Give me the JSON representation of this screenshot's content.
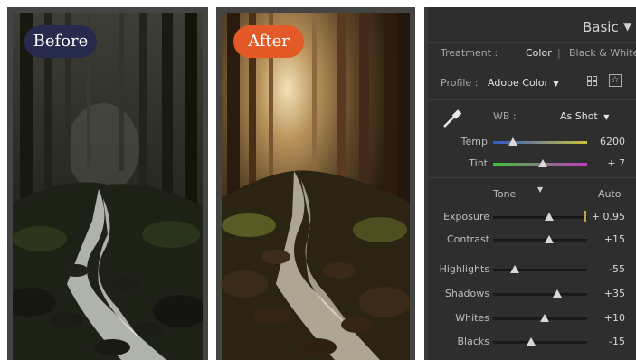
{
  "comparison": {
    "before_label": "Before",
    "after_label": "After",
    "before_pill_color": "#262a4d",
    "after_pill_color": "#e35a26"
  },
  "panel": {
    "title": "Basic",
    "treatment": {
      "label": "Treatment :",
      "option_color": "Color",
      "divider": "|",
      "option_bw": "Black & White"
    },
    "profile": {
      "label": "Profile :",
      "value": "Adobe Color"
    },
    "wb": {
      "label": "WB :",
      "value": "As Shot"
    },
    "temp": {
      "label": "Temp",
      "value": "6200",
      "level": 0.21
    },
    "tint": {
      "label": "Tint",
      "value": "+ 7",
      "level": 0.53
    },
    "tone": {
      "label": "Tone",
      "auto": "Auto"
    },
    "sliders": [
      {
        "label": "Exposure",
        "value": "+ 0.95",
        "level": 0.6
      },
      {
        "label": "Contrast",
        "value": "+15",
        "level": 0.6
      },
      {
        "label": "Highlights",
        "value": "-55",
        "level": 0.23
      },
      {
        "label": "Shadows",
        "value": "+35",
        "level": 0.68
      },
      {
        "label": "Whites",
        "value": "+10",
        "level": 0.55
      },
      {
        "label": "Blacks",
        "value": "-15",
        "level": 0.4
      }
    ]
  }
}
